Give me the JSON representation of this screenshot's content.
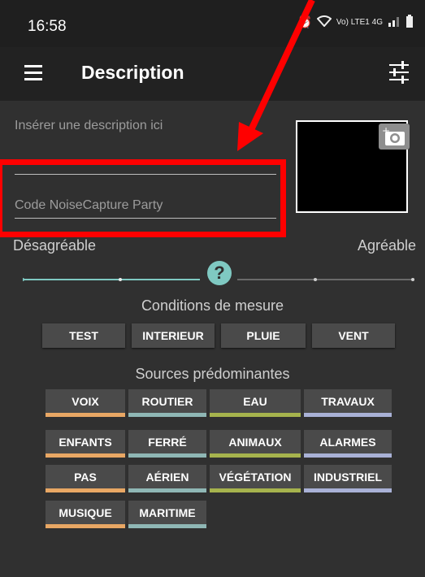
{
  "status": {
    "time": "16:58",
    "network": "Vo) LTE1 4G"
  },
  "appbar": {
    "title": "Description"
  },
  "form": {
    "description_placeholder": "Insérer une description ici",
    "party_code_placeholder": "Code NoiseCapture Party"
  },
  "slider": {
    "left_label": "Désagréable",
    "right_label": "Agréable",
    "thumb_label": "?",
    "level": 0.5
  },
  "conditions": {
    "title": "Conditions de mesure",
    "buttons": [
      "TEST",
      "INTERIEUR",
      "PLUIE",
      "VENT"
    ]
  },
  "sources": {
    "title": "Sources prédominantes",
    "tags": [
      {
        "label": "VOIX",
        "color": "#e8a764"
      },
      {
        "label": "ROUTIER",
        "color": "#8fb7b5"
      },
      {
        "label": "EAU",
        "color": "#a6b34d"
      },
      {
        "label": "TRAVAUX",
        "color": "#a9b1d6"
      },
      {
        "label": "ENFANTS",
        "color": "#e8a764"
      },
      {
        "label": "FERRÉ",
        "color": "#8fb7b5"
      },
      {
        "label": "ANIMAUX",
        "color": "#a6b34d"
      },
      {
        "label": "ALARMES",
        "color": "#a9b1d6"
      },
      {
        "label": "PAS",
        "color": "#e8a764"
      },
      {
        "label": "AÉRIEN",
        "color": "#8fb7b5"
      },
      {
        "label": "VÉGÉTATION",
        "color": "#a6b34d"
      },
      {
        "label": "INDUSTRIEL",
        "color": "#a9b1d6"
      },
      {
        "label": "MUSIQUE",
        "color": "#e8a764"
      },
      {
        "label": "MARITIME",
        "color": "#8fb7b5"
      }
    ]
  },
  "colors": {
    "annotation_red": "#ff0000",
    "slider_active": "#7fc9c2"
  }
}
